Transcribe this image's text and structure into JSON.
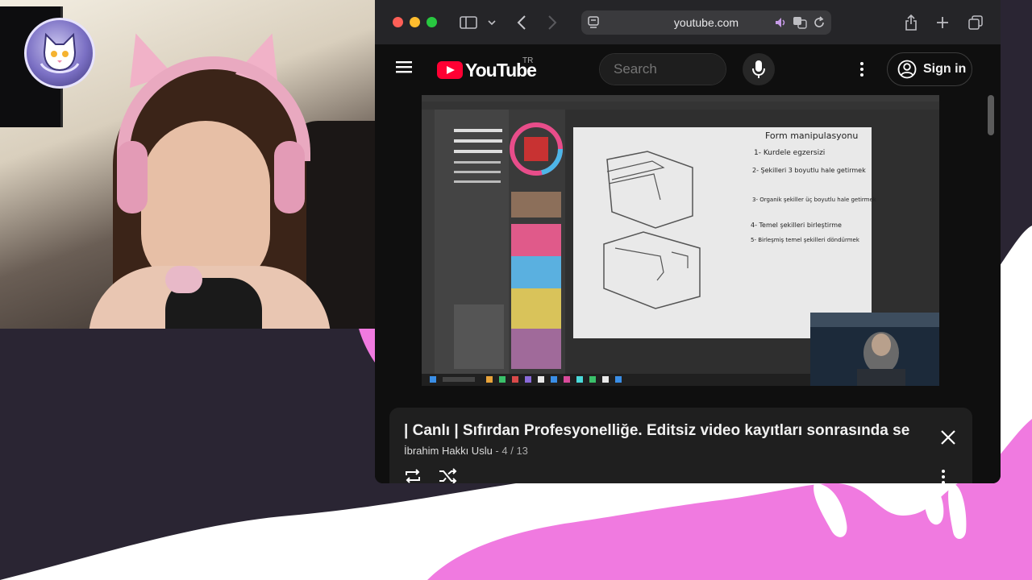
{
  "browser": {
    "url": "youtube.com"
  },
  "youtube": {
    "logo_text": "YouTube",
    "region": "TR",
    "search_placeholder": "Search",
    "sign_in_label": "Sign in"
  },
  "video_content": {
    "notes_title": "Form manipulasyonu",
    "notes": [
      "1- Kurdele egzersizi",
      "2- Şekilleri 3 boyutlu hale getirmek",
      "3- Organik şekiller üç boyutlu hale getirmek",
      "4- Temel şekilleri birleştirme",
      "5- Birleşmiş temel şekilleri döndürmek"
    ]
  },
  "playlist": {
    "title": "| Canlı |  Sıfırdan  Profesyonelliğe. Editsiz video kayıtları sonrasında se",
    "channel": "İbrahim Hakkı Uslu",
    "separator": " - ",
    "position": "4 / 13"
  },
  "colors": {
    "brand_red": "#ff0033",
    "stream_pink": "#f07ae0",
    "stream_dark": "#2a2533"
  }
}
